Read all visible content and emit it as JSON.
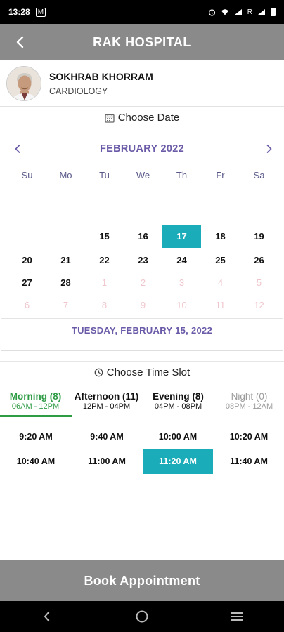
{
  "status_bar": {
    "time": "13:28",
    "left_icon": "M",
    "right_text": "R"
  },
  "header": {
    "title": "RAK HOSPITAL",
    "back_icon": "chevron-left-icon"
  },
  "doctor": {
    "name": "SOKHRAB KHORRAM",
    "department": "CARDIOLOGY"
  },
  "date_section": {
    "label": "Choose Date",
    "icon": "calendar-icon"
  },
  "calendar": {
    "month_label": "FEBRUARY 2022",
    "weekdays": [
      "Su",
      "Mo",
      "Tu",
      "We",
      "Th",
      "Fr",
      "Sa"
    ],
    "days": [
      {
        "label": "15",
        "faded": false,
        "selected": false
      },
      {
        "label": "16",
        "faded": false,
        "selected": false
      },
      {
        "label": "17",
        "faded": false,
        "selected": true
      },
      {
        "label": "18",
        "faded": false,
        "selected": false
      },
      {
        "label": "19",
        "faded": false,
        "selected": false
      },
      {
        "label": "20",
        "faded": false,
        "selected": false
      },
      {
        "label": "21",
        "faded": false,
        "selected": false
      },
      {
        "label": "22",
        "faded": false,
        "selected": false
      },
      {
        "label": "23",
        "faded": false,
        "selected": false
      },
      {
        "label": "24",
        "faded": false,
        "selected": false
      },
      {
        "label": "25",
        "faded": false,
        "selected": false
      },
      {
        "label": "26",
        "faded": false,
        "selected": false
      },
      {
        "label": "27",
        "faded": false,
        "selected": false
      },
      {
        "label": "28",
        "faded": false,
        "selected": false
      },
      {
        "label": "1",
        "faded": true,
        "selected": false
      },
      {
        "label": "2",
        "faded": true,
        "selected": false
      },
      {
        "label": "3",
        "faded": true,
        "selected": false
      },
      {
        "label": "4",
        "faded": true,
        "selected": false
      },
      {
        "label": "5",
        "faded": true,
        "selected": false
      },
      {
        "label": "6",
        "faded": true,
        "selected": false
      },
      {
        "label": "7",
        "faded": true,
        "selected": false
      },
      {
        "label": "8",
        "faded": true,
        "selected": false
      },
      {
        "label": "9",
        "faded": true,
        "selected": false
      },
      {
        "label": "10",
        "faded": true,
        "selected": false
      },
      {
        "label": "11",
        "faded": true,
        "selected": false
      },
      {
        "label": "12",
        "faded": true,
        "selected": false
      }
    ],
    "selected_date_text": "TUESDAY, FEBRUARY 15, 2022"
  },
  "time_section": {
    "label": "Choose Time Slot",
    "icon": "clock-icon"
  },
  "tabs": [
    {
      "label": "Morning (8)",
      "range": "06AM - 12PM",
      "state": "active"
    },
    {
      "label": "Afternoon (11)",
      "range": "12PM - 04PM",
      "state": "normal"
    },
    {
      "label": "Evening (8)",
      "range": "04PM - 08PM",
      "state": "normal"
    },
    {
      "label": "Night (0)",
      "range": "08PM - 12AM",
      "state": "disabled"
    }
  ],
  "slots": [
    {
      "label": "9:20 AM",
      "selected": false
    },
    {
      "label": "9:40 AM",
      "selected": false
    },
    {
      "label": "10:00 AM",
      "selected": false
    },
    {
      "label": "10:20 AM",
      "selected": false
    },
    {
      "label": "10:40 AM",
      "selected": false
    },
    {
      "label": "11:00 AM",
      "selected": false
    },
    {
      "label": "11:20 AM",
      "selected": true
    },
    {
      "label": "11:40 AM",
      "selected": false
    }
  ],
  "book_button": {
    "label": "Book Appointment"
  },
  "colors": {
    "header_bg": "#8a8a8a",
    "accent_teal": "#1aacb8",
    "month_purple": "#6a5aa8",
    "active_tab_green": "#2e9b45",
    "faded_day": "#f0c6cc"
  }
}
